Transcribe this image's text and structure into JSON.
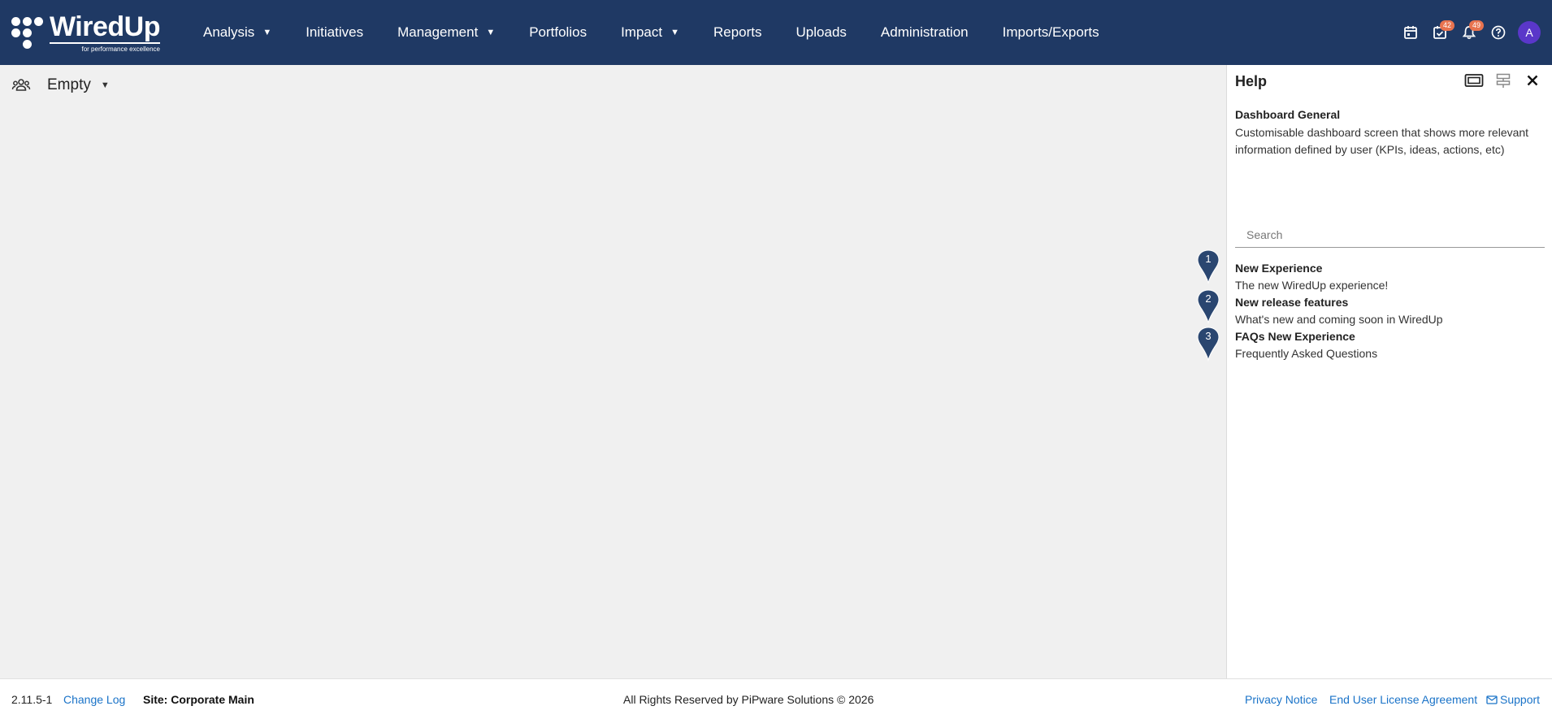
{
  "app": {
    "logo_name": "WiredUp",
    "logo_tagline": "for performance excellence"
  },
  "nav": {
    "items": [
      {
        "label": "Analysis",
        "has_dropdown": true
      },
      {
        "label": "Initiatives",
        "has_dropdown": false
      },
      {
        "label": "Management",
        "has_dropdown": true
      },
      {
        "label": "Portfolios",
        "has_dropdown": false
      },
      {
        "label": "Impact",
        "has_dropdown": true
      },
      {
        "label": "Reports",
        "has_dropdown": false
      },
      {
        "label": "Uploads",
        "has_dropdown": false
      },
      {
        "label": "Administration",
        "has_dropdown": false
      },
      {
        "label": "Imports/Exports",
        "has_dropdown": false
      }
    ]
  },
  "top_icons": {
    "calendar": "calendar-icon",
    "tasks": "task-check-icon",
    "tasks_badge": "42",
    "notifications": "bell-icon",
    "notifications_badge": "49",
    "help": "help-icon",
    "avatar_initial": "A"
  },
  "filter": {
    "icon": "people-icon",
    "label": "Empty"
  },
  "help_panel": {
    "title": "Help",
    "section_title": "Dashboard General",
    "section_description": "Customisable dashboard screen that shows more relevant information defined by user (KPIs, ideas, actions, etc)",
    "search_placeholder": "Search",
    "items": [
      {
        "number": "1",
        "title": "New Experience",
        "description": "The new WiredUp experience!"
      },
      {
        "number": "2",
        "title": "New release features",
        "description": "What's new and coming soon in WiredUp"
      },
      {
        "number": "3",
        "title": "FAQs New Experience",
        "description": "Frequently Asked Questions"
      }
    ]
  },
  "footer": {
    "version": "2.11.5-1",
    "change_log": "Change Log",
    "site": "Site: Corporate Main",
    "copyright": "All Rights Reserved by PiPware Solutions © 2026",
    "privacy": "Privacy Notice",
    "eula": "End User License Agreement",
    "support": "Support"
  },
  "colors": {
    "header_bg": "#1f3964",
    "badge": "#e8734f",
    "avatar": "#5a37c9",
    "link": "#1a73c8",
    "pin": "#2a4670"
  }
}
